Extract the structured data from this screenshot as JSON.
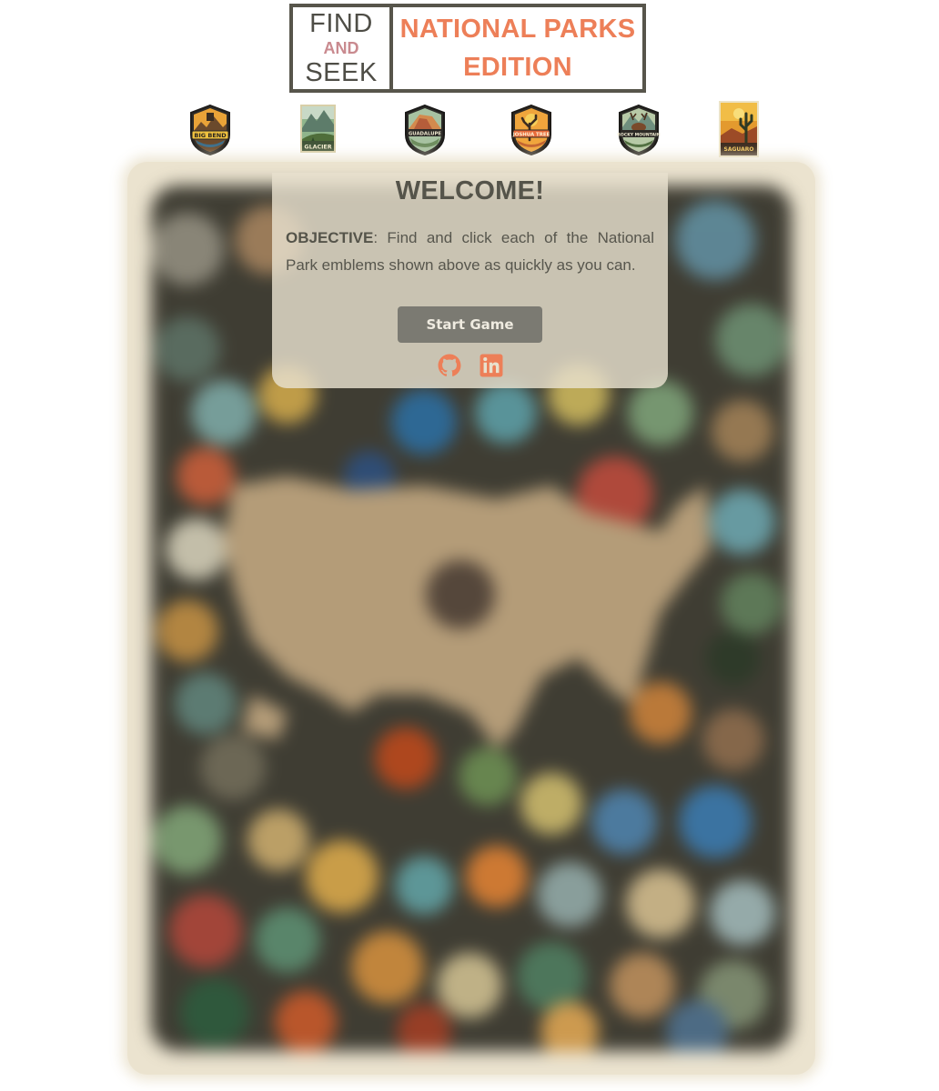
{
  "logo": {
    "find": "FIND",
    "and": "AND",
    "seek": "SEEK",
    "line1": "NATIONAL PARKS",
    "line2": "EDITION"
  },
  "emblems": [
    {
      "name": "big-bend",
      "label": "BIG BEND",
      "shape": "shield"
    },
    {
      "name": "glacier",
      "label": "GLACIER",
      "shape": "poster"
    },
    {
      "name": "guadalupe",
      "label": "GUADALUPE",
      "shape": "shield"
    },
    {
      "name": "joshua-tree",
      "label": "JOSHUA TREE",
      "shape": "shield"
    },
    {
      "name": "rocky-mountain",
      "label": "ROCKY MOUNTAIN",
      "shape": "shield"
    },
    {
      "name": "saguaro",
      "label": "SAGUARO",
      "shape": "poster"
    }
  ],
  "modal": {
    "title": "WELCOME!",
    "objective_label": "OBJECTIVE",
    "objective_text": ": Find and click each of the National Park emblems shown above as quickly as you can.",
    "start_button": "Start Game"
  },
  "social": {
    "github_icon": "github-icon",
    "linkedin_icon": "linkedin-icon"
  },
  "colors": {
    "logo_dark": "#57554b",
    "logo_accent": "#ed7f58",
    "logo_and": "#c98a8f",
    "board_bg": "#ebe3cf",
    "modal_bg": "#e8e1ce",
    "button_bg": "#7b7a72",
    "social_icon": "#ed7f58"
  }
}
